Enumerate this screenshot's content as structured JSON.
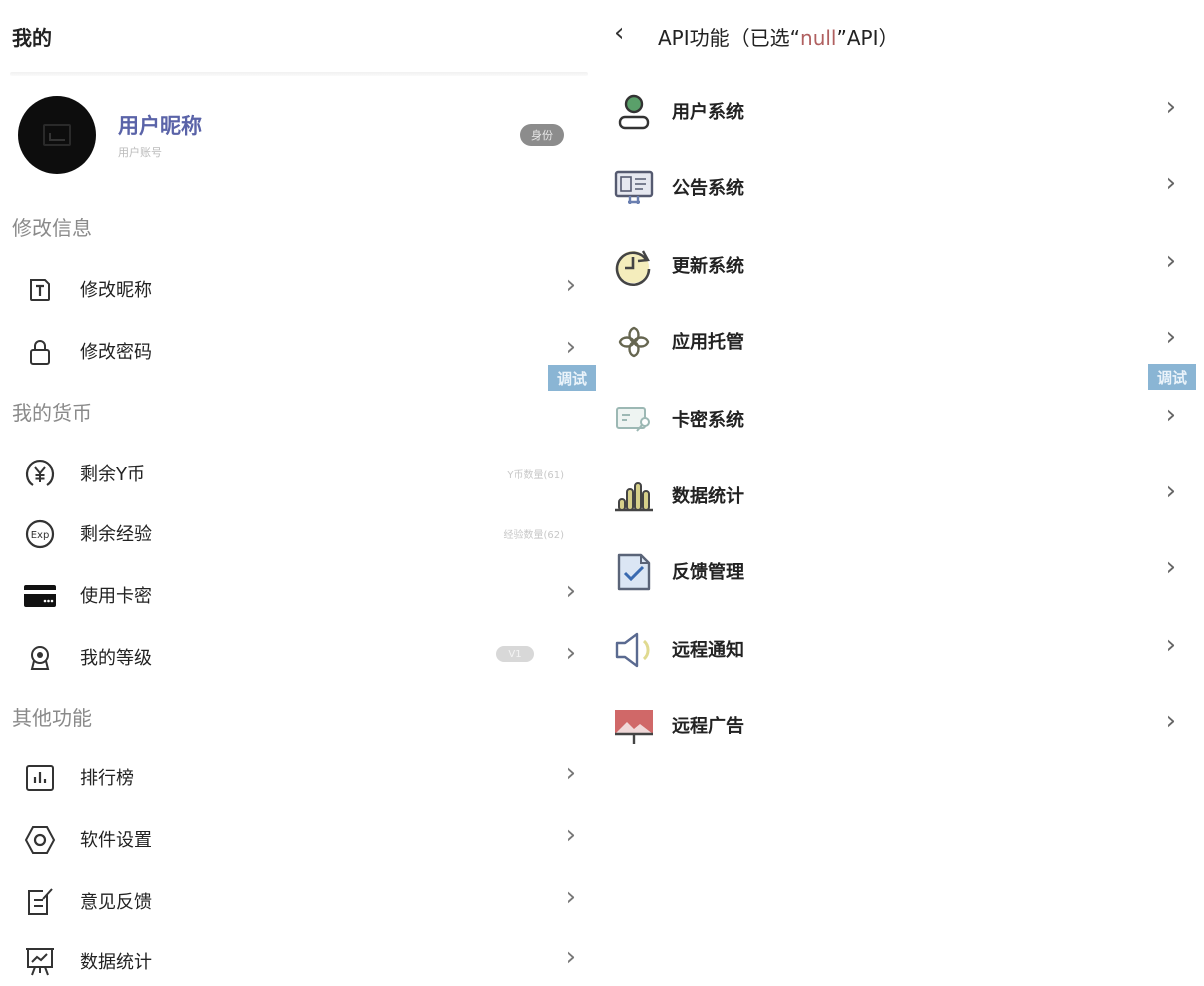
{
  "left": {
    "page_title": "我的",
    "profile": {
      "nickname": "用户昵称",
      "account": "用户账号",
      "identity_badge": "身份"
    },
    "sections": [
      {
        "title": "修改信息",
        "items": [
          {
            "label": "修改昵称",
            "icon": "text-t-icon"
          },
          {
            "label": "修改密码",
            "icon": "lock-icon"
          }
        ]
      },
      {
        "title": "我的货币",
        "items": [
          {
            "label": "剩余Y币",
            "icon": "yen-coin-icon",
            "hint": "Y币数量(61)"
          },
          {
            "label": "剩余经验",
            "icon": "exp-icon",
            "hint": "经验数量(62)"
          },
          {
            "label": "使用卡密",
            "icon": "card-icon"
          },
          {
            "label": "我的等级",
            "icon": "badge-icon",
            "level_badge": "V1"
          }
        ]
      },
      {
        "title": "其他功能",
        "items": [
          {
            "label": "排行榜",
            "icon": "bar-chart-icon"
          },
          {
            "label": "软件设置",
            "icon": "settings-hexagon-icon"
          },
          {
            "label": "意见反馈",
            "icon": "feedback-edit-icon"
          },
          {
            "label": "数据统计",
            "icon": "presentation-chart-icon"
          }
        ]
      }
    ],
    "debug_tag": "调试"
  },
  "right": {
    "title_prefix": "API功能（已选“",
    "title_null": "null",
    "title_suffix": "”API）",
    "items": [
      {
        "label": "用户系统",
        "icon": "user-icon"
      },
      {
        "label": "公告系统",
        "icon": "notice-board-icon"
      },
      {
        "label": "更新系统",
        "icon": "refresh-clock-icon"
      },
      {
        "label": "应用托管",
        "icon": "clover-knot-icon"
      },
      {
        "label": "卡密系统",
        "icon": "card-key-icon"
      },
      {
        "label": "数据统计",
        "icon": "bar-stats-icon"
      },
      {
        "label": "反馈管理",
        "icon": "doc-check-icon"
      },
      {
        "label": "远程通知",
        "icon": "speaker-icon"
      },
      {
        "label": "远程广告",
        "icon": "billboard-icon"
      }
    ],
    "debug_tag": "调试"
  },
  "colors": {
    "nickname": "#5a63a8",
    "debug_tag_bg": "#8ab5d4",
    "null_highlight": "#b06060"
  }
}
